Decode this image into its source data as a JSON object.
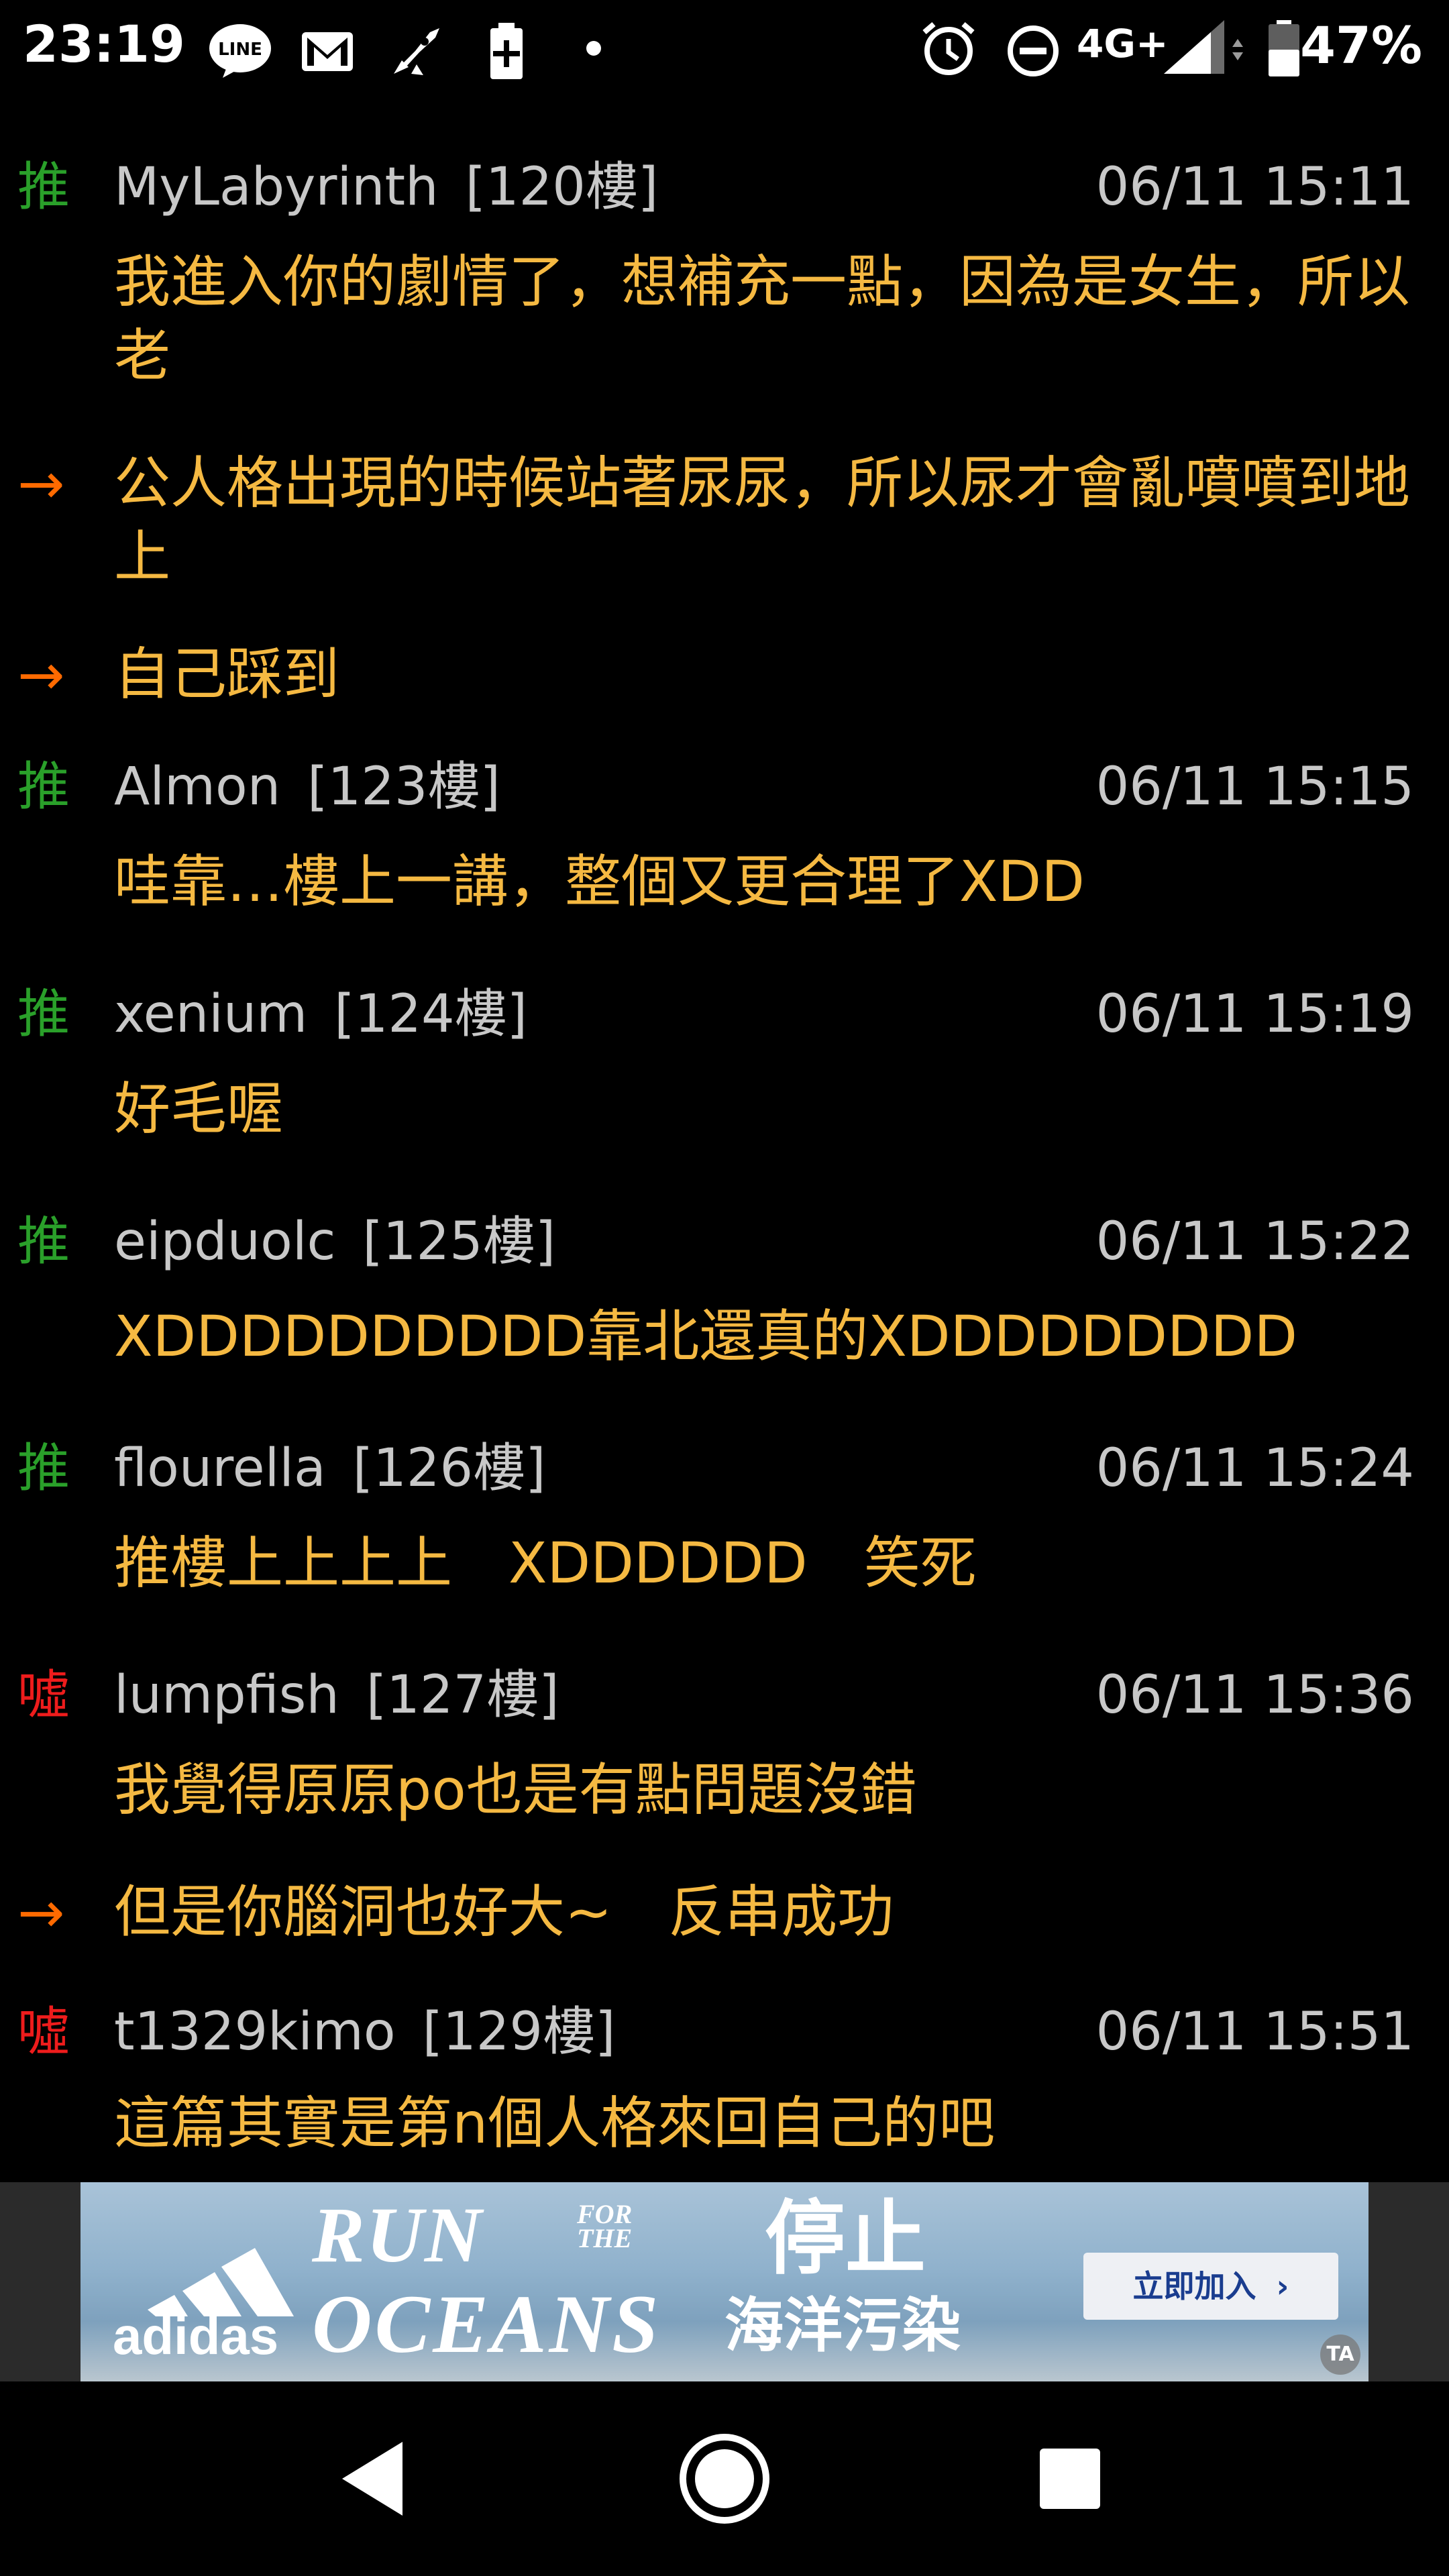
{
  "status_bar": {
    "time": "23:19",
    "left_icons": [
      "line-icon",
      "gmail-icon",
      "rocket-icon",
      "battery-saver-icon",
      "dot-icon"
    ],
    "right_icons": [
      "alarm-icon",
      "do-not-disturb-icon",
      "signal-icon",
      "battery-icon"
    ],
    "network": "4G+",
    "battery_percent": "47%"
  },
  "comments": [
    {
      "type": "tag",
      "tag": "推",
      "tag_kind": "push",
      "user": "MyLabyrinth",
      "floor": "[120樓]",
      "time": "06/11 15:11",
      "message": "我進入你的劇情了，想補充一點，因為是女生，所以老"
    },
    {
      "type": "continuation",
      "tag": "→",
      "message": "公人格出現的時候站著尿尿，所以尿才會亂噴噴到地上"
    },
    {
      "type": "continuation",
      "tag": "→",
      "message": "自己踩到"
    },
    {
      "type": "tag",
      "tag": "推",
      "tag_kind": "push",
      "user": "Almon",
      "floor": "[123樓]",
      "time": "06/11 15:15",
      "message": "哇靠…樓上一講，整個又更合理了XDD"
    },
    {
      "type": "tag",
      "tag": "推",
      "tag_kind": "push",
      "user": "xenium",
      "floor": "[124樓]",
      "time": "06/11 15:19",
      "message": "好毛喔"
    },
    {
      "type": "tag",
      "tag": "推",
      "tag_kind": "push",
      "user": "eipduolc",
      "floor": "[125樓]",
      "time": "06/11 15:22",
      "message": "XDDDDDDDDDD靠北還真的XDDDDDDDDD"
    },
    {
      "type": "tag",
      "tag": "推",
      "tag_kind": "push",
      "user": "flourella",
      "floor": "[126樓]",
      "time": "06/11 15:24",
      "message": "推樓上上上上　XDDDDDD　笑死"
    },
    {
      "type": "tag",
      "tag": "噓",
      "tag_kind": "boo",
      "user": "lumpfish",
      "floor": "[127樓]",
      "time": "06/11 15:36",
      "message": "我覺得原原po也是有點問題沒錯"
    },
    {
      "type": "continuation",
      "tag": "→",
      "message": "但是你腦洞也好大~　反串成功"
    },
    {
      "type": "tag",
      "tag": "噓",
      "tag_kind": "boo",
      "user": "t1329kimo",
      "floor": "[129樓]",
      "time": "06/11 15:51",
      "message": "這篇其實是第n個人格來回自己的吧"
    }
  ],
  "ad": {
    "brand": "adidas",
    "run": "RUN",
    "for_the": "FOR THE",
    "oceans": "OCEANS",
    "stop": "停止",
    "ocean_pollution": "海洋污染",
    "cta": "立即加入",
    "cta_icon": "chevron-right-icon",
    "badge": "TA"
  },
  "nav_bar": {
    "back": "back-icon",
    "home": "home-icon",
    "recents": "recents-icon"
  },
  "colors": {
    "push": "#2aa02a",
    "boo": "#ee1c1c",
    "arrow": "#ff6a00",
    "message": "#f5b942",
    "meta": "#c8c8c8"
  }
}
